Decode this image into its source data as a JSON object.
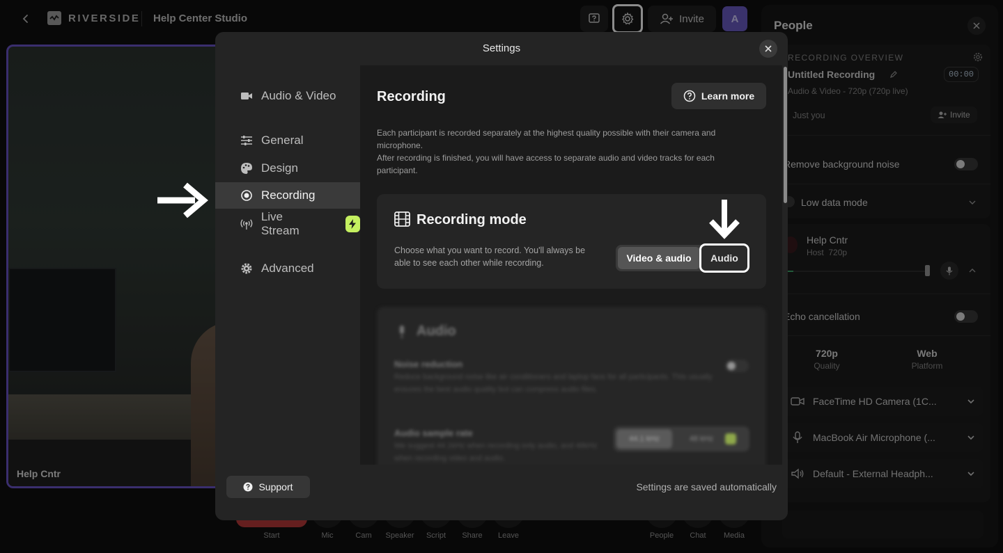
{
  "topbar": {
    "brand": "RIVERSIDE",
    "studio_title": "Help Center Studio",
    "invite_label": "Invite",
    "avatar_initial": "A"
  },
  "video": {
    "participant_label": "Help Cntr"
  },
  "bottombar": {
    "items": [
      "Start",
      "Mic",
      "Cam",
      "Speaker",
      "Script",
      "Share",
      "Leave",
      "People",
      "Chat",
      "Media"
    ],
    "start_color": "#b83a3a"
  },
  "people": {
    "title": "People",
    "overview_label": "RECORDING OVERVIEW",
    "recording_name": "Untitled Recording",
    "recording_meta": "Audio & Video - 720p (720p live)",
    "timer": "00:00",
    "participants_text": "Just you",
    "invite_label": "Invite",
    "remove_noise_label": "Remove background noise",
    "low_data_label": "Low data mode",
    "host_name": "Help Cntr",
    "host_meta": "Host  720p",
    "echo_label": "Echo cancellation",
    "quality_value": "720p",
    "quality_label": "Quality",
    "platform_value": "Web",
    "platform_label": "Platform",
    "devices": [
      {
        "icon": "camera-icon",
        "label": "FaceTime HD Camera (1C..."
      },
      {
        "icon": "microphone-icon",
        "label": "MacBook Air Microphone (..."
      },
      {
        "icon": "speaker-icon",
        "label": "Default - External Headph..."
      }
    ]
  },
  "modal": {
    "title": "Settings",
    "nav": [
      {
        "label": "Audio & Video",
        "icon": "video-camera-icon"
      },
      {
        "label": "General",
        "icon": "sliders-icon"
      },
      {
        "label": "Design",
        "icon": "palette-icon"
      },
      {
        "label": "Recording",
        "icon": "record-icon",
        "active": true
      },
      {
        "label": "Live Stream",
        "icon": "broadcast-icon"
      },
      {
        "label": "Advanced",
        "icon": "gear-icon"
      }
    ],
    "content": {
      "title": "Recording",
      "learn_more": "Learn more",
      "description_1": "Each participant is recorded separately at the highest quality possible with their camera and microphone.",
      "description_2": "After recording is finished, you will have access to separate audio and video tracks for each participant.",
      "mode_title": "Recording mode",
      "mode_desc": "Choose what you want to record. You'll always be able to see each other while recording.",
      "mode_options": [
        "Video & audio",
        "Audio"
      ],
      "mode_selected": "Video & audio",
      "audio_section_title": "Audio",
      "noise_title": "Noise reduction",
      "noise_desc": "Reduce background noise like air conditioners and laptop fans for all participants. This usually ensures the best audio quality but can compress audio files.",
      "sample_title": "Audio sample rate",
      "sample_desc": "We suggest 44.1kHz when recording only audio, and 48kHz when recording video and audio.",
      "sample_options": [
        "44.1 kHz",
        "48 kHz"
      ]
    },
    "support_label": "Support",
    "saved_text": "Settings are saved automatically"
  },
  "colors": {
    "accent_purple": "#6b55c8",
    "live_badge": "#c5f060",
    "highlight": "#ffffff"
  }
}
